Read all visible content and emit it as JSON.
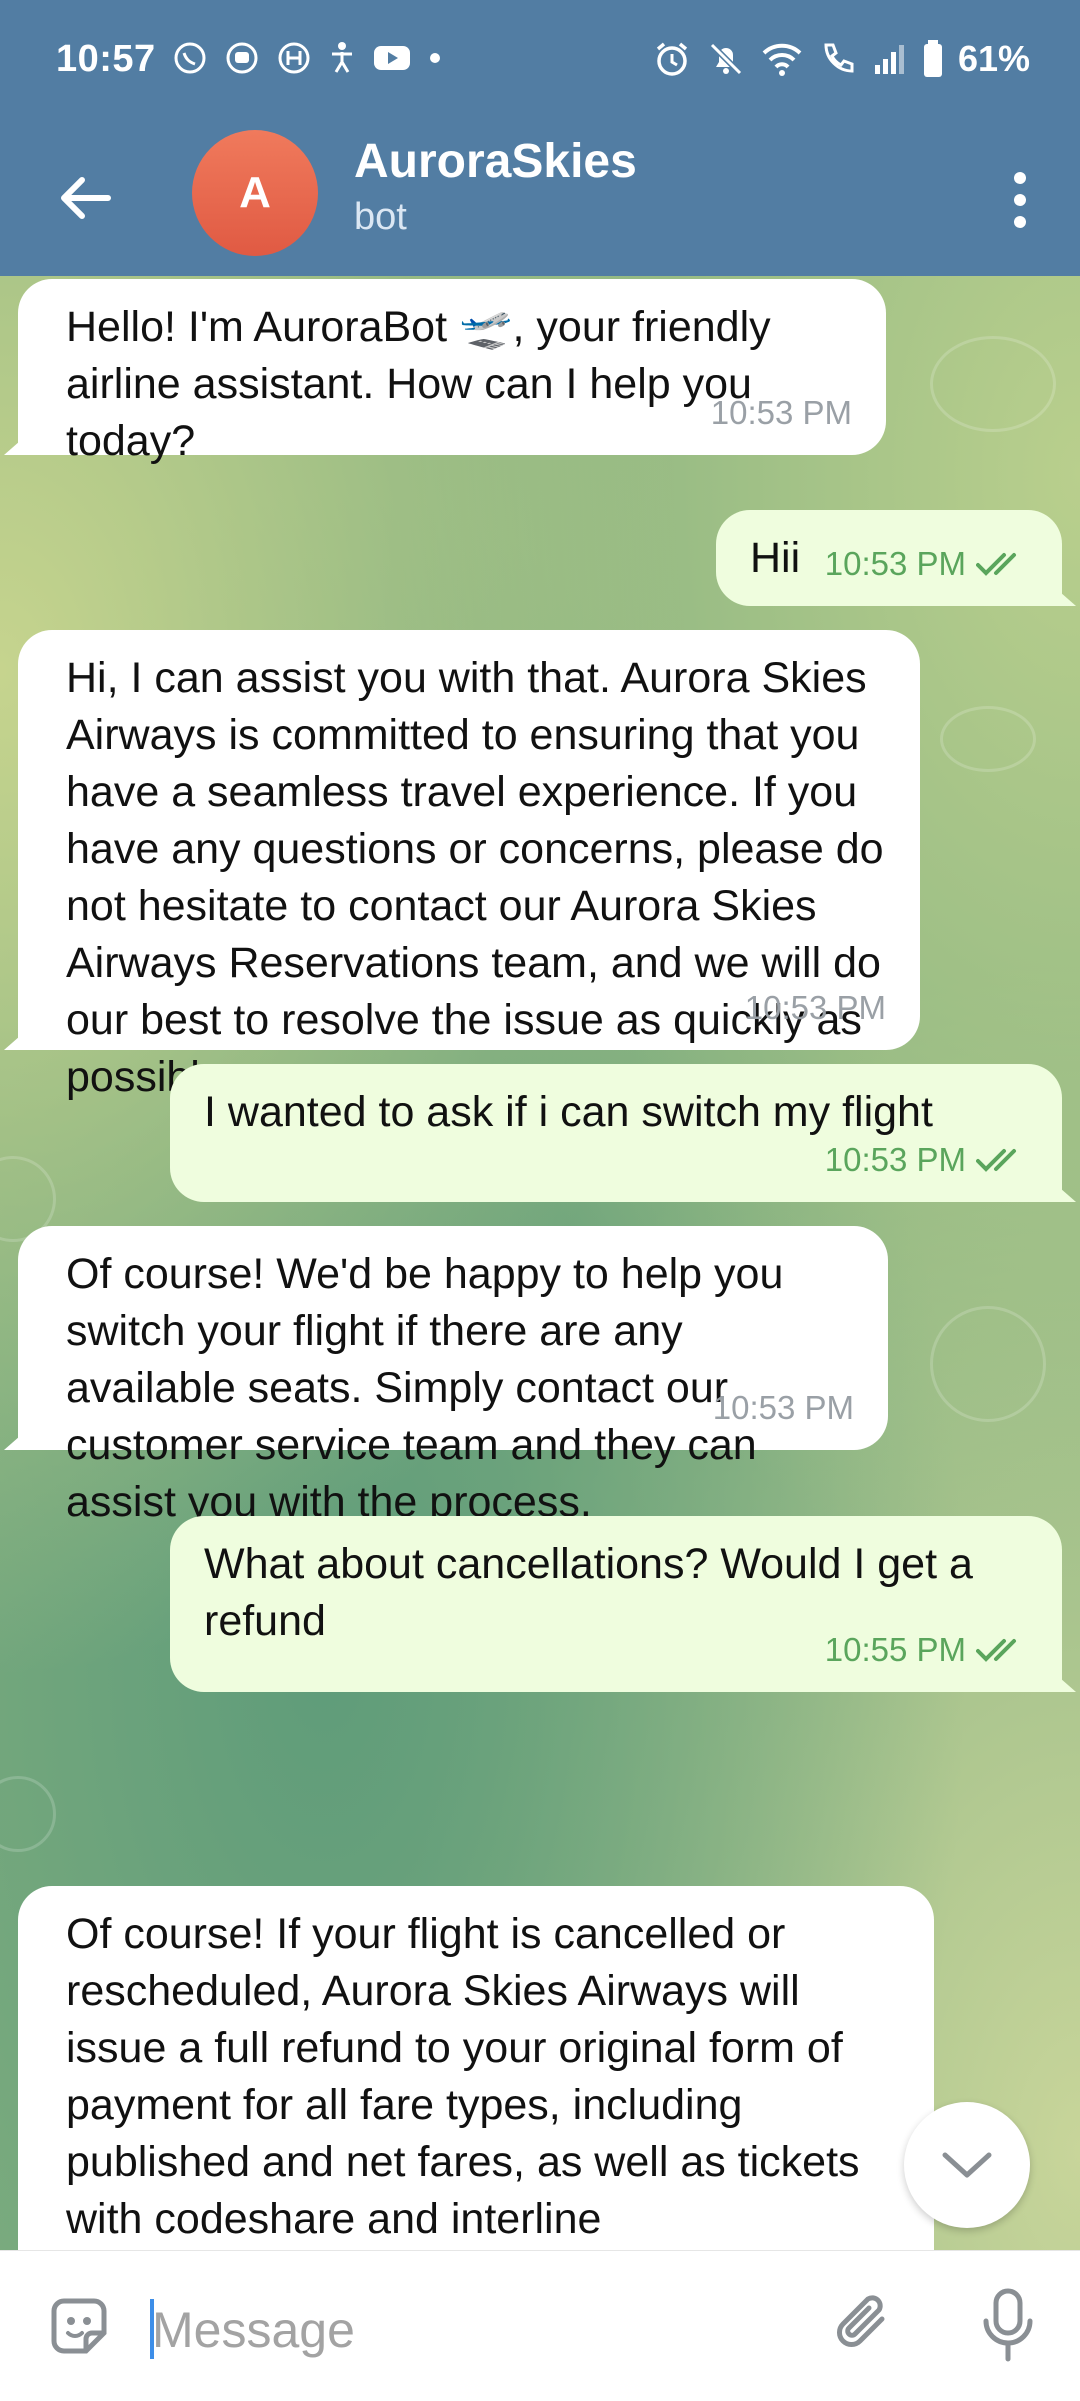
{
  "status_bar": {
    "time": "10:57",
    "battery": "61%"
  },
  "header": {
    "title": "AuroraSkies",
    "subtitle": "bot",
    "avatar_letter": "A"
  },
  "messages": [
    {
      "direction": "in",
      "text": "Hello! I'm AuroraBot 🛫, your friendly airline assistant. How can I help you today?",
      "time": "10:53 PM"
    },
    {
      "direction": "out",
      "text": "Hii",
      "time": "10:53 PM"
    },
    {
      "direction": "in",
      "text": "Hi, I can assist you with that. Aurora Skies Airways is committed to ensuring that you have a seamless travel experience. If you have any questions or concerns, please do not hesitate to contact our Aurora Skies Airways Reservations team, and we will do our best to resolve the issue as quickly as possible.",
      "time": "10:53 PM"
    },
    {
      "direction": "out",
      "text": "I wanted to ask if i can switch my flight",
      "time": "10:53 PM"
    },
    {
      "direction": "in",
      "text": "Of course! We'd be happy to help you switch your flight if there are any available seats. Simply contact our customer service team and they can assist you with the process.",
      "time": "10:53 PM"
    },
    {
      "direction": "out",
      "text": "What about cancellations? Would I get a refund",
      "time": "10:55 PM"
    },
    {
      "direction": "in",
      "text": "Of course! If your flight is cancelled or rescheduled, Aurora Skies Airways will issue a full refund to your original form of payment for all fare types, including published and net fares, as well as tickets with codeshare and interline",
      "time": ""
    }
  ],
  "composer": {
    "placeholder": "Message"
  },
  "colors": {
    "header": "#527da3",
    "outgoing_bubble": "#effdde",
    "check": "#5aa55c",
    "avatar": "#e8664d"
  }
}
